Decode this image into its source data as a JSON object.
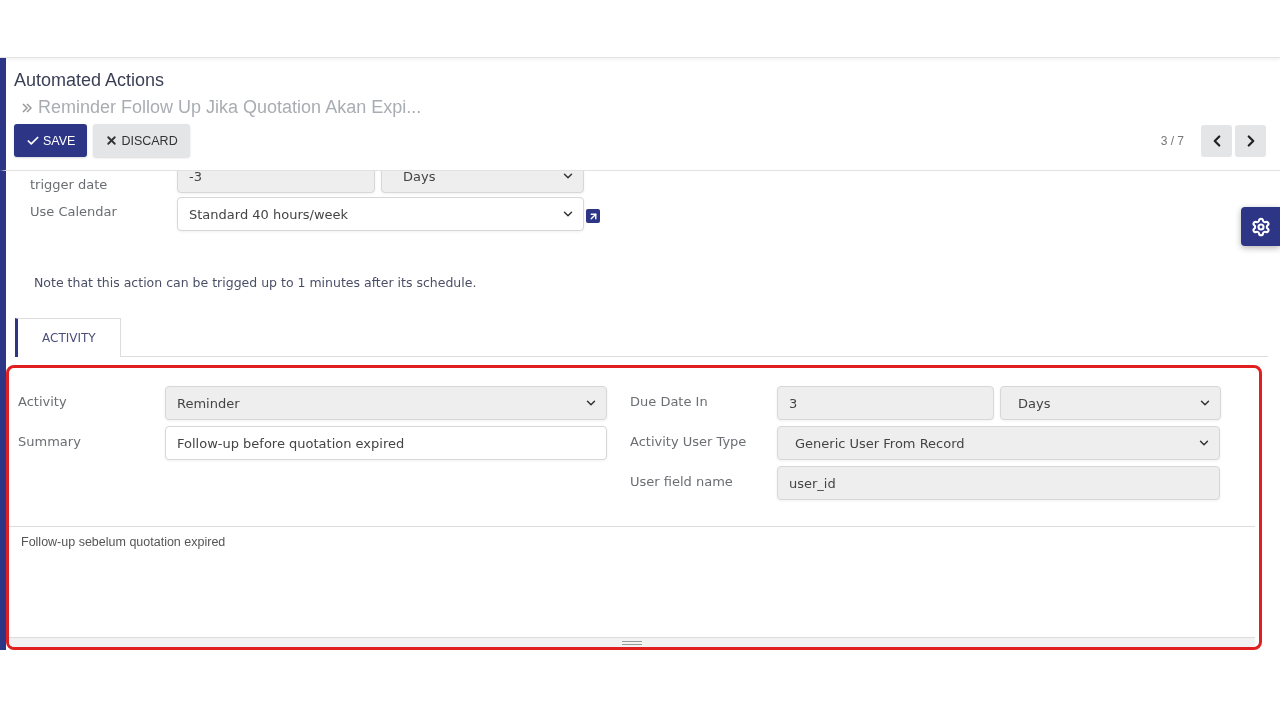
{
  "breadcrumb": {
    "title": "Automated Actions",
    "record": "Reminder Follow Up Jika Quotation Akan Expi..."
  },
  "buttons": [
    {
      "kind": "primary",
      "label": "SAVE"
    },
    {
      "kind": "secondary",
      "label": "DISCARD"
    }
  ],
  "pager": {
    "value": "3 / 7"
  },
  "schedule": {
    "trigger_label": "trigger date",
    "delay": "-3",
    "delay_unit": "Days",
    "calendar_label": "Use Calendar",
    "calendar": "Standard 40 hours/week",
    "note": "Note that this action can be trigged up to 1 minutes after its schedule."
  },
  "tabs": [
    {
      "label": "ACTIVITY",
      "selected": true
    }
  ],
  "activity": {
    "left": [
      {
        "kind": "select",
        "label": "Activity",
        "value": "Reminder"
      },
      {
        "kind": "input",
        "label": "Summary",
        "value": "Follow-up before quotation expired"
      }
    ],
    "right": [
      {
        "kind": "pair",
        "label": "Due Date In",
        "value": "3",
        "unit": "Days"
      },
      {
        "kind": "dropdown",
        "label": "Activity User Type",
        "value": "Generic User From Record"
      },
      {
        "kind": "readonly",
        "label": "User field name",
        "value": "user_id"
      }
    ],
    "note": "Follow-up sebelum quotation expired"
  }
}
